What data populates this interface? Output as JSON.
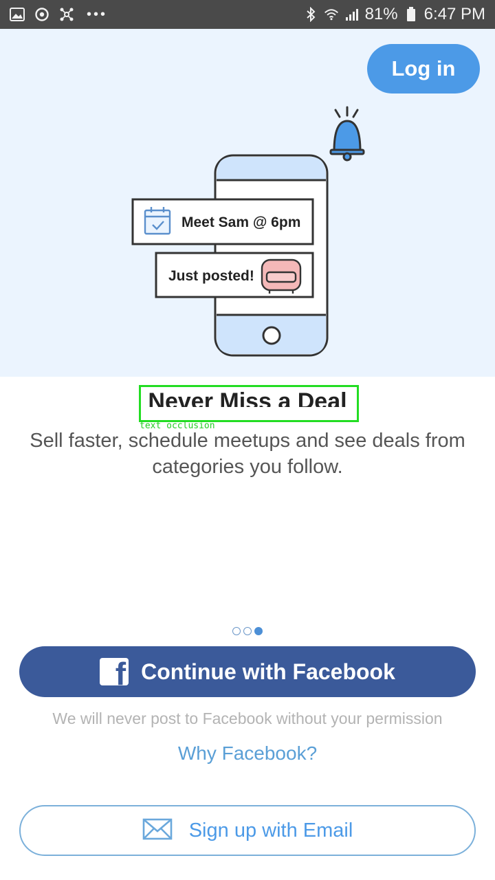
{
  "status_bar": {
    "battery": "81%",
    "time": "6:47 PM",
    "left_icons": [
      "gallery-icon",
      "sync-icon",
      "network-icon",
      "more-dots-icon"
    ],
    "right_icons": [
      "bluetooth-icon",
      "wifi-icon",
      "signal-icon",
      "battery-icon"
    ]
  },
  "hero": {
    "login_label": "Log in",
    "card_meet": "Meet Sam @ 6pm",
    "card_posted": "Just posted!",
    "colors": {
      "background": "#ebf4fe",
      "accent": "#4c9ae7"
    }
  },
  "content": {
    "title": "Never Miss a Deal",
    "occlusion_label": "text occlusion",
    "subtitle": "Sell faster, schedule meetups and see deals from categories you follow."
  },
  "pager": {
    "count": 3,
    "active_index": 2
  },
  "actions": {
    "facebook_label": "Continue with Facebook",
    "facebook_note": "We will never post to Facebook without your permission",
    "why_facebook": "Why Facebook?",
    "email_label": "Sign up with Email",
    "colors": {
      "facebook": "#3b5a9a",
      "link": "#5a9fd6"
    }
  }
}
